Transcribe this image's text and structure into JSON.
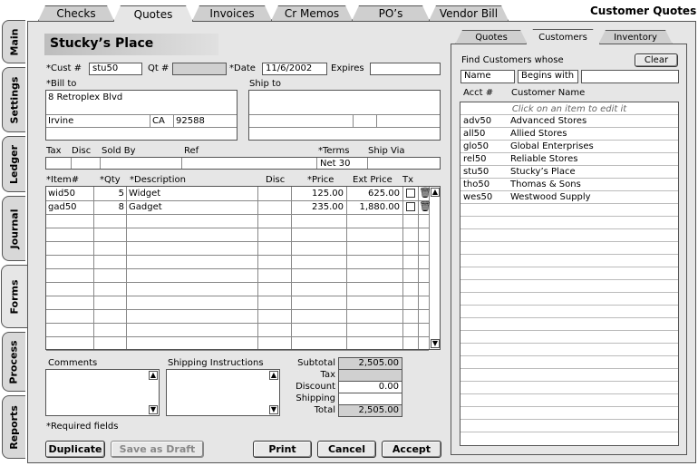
{
  "window_title": "Customer Quotes",
  "left_tabs": [
    "Main",
    "Settings",
    "Ledger",
    "Journal",
    "Forms",
    "Process",
    "Reports"
  ],
  "top_tabs": [
    "Checks",
    "Quotes",
    "Invoices",
    "Cr Memos",
    "PO’s",
    "Vendor Bill"
  ],
  "customer_name": "Stucky’s Place",
  "header": {
    "cust_label": "*Cust #",
    "cust_value": "stu50",
    "qt_label": "Qt #",
    "qt_value": "",
    "date_label": "*Date",
    "date_value": "11/6/2002",
    "expires_label": "Expires",
    "expires_value": ""
  },
  "bill_to": {
    "label": "*Bill to",
    "line1": "8 Retroplex Blvd",
    "city": "Irvine",
    "state": "CA",
    "zip": "92588"
  },
  "ship_to": {
    "label": "Ship to"
  },
  "terms_row": {
    "tax": "Tax",
    "disc": "Disc",
    "sold_by": "Sold By",
    "ref": "Ref",
    "terms": "*Terms",
    "ship_via": "Ship Via",
    "terms_value": "Net 30"
  },
  "items_header": {
    "item": "*Item#",
    "qty": "*Qty",
    "desc": "*Description",
    "disc": "Disc",
    "price": "*Price",
    "ext": "Ext Price",
    "tx": "Tx"
  },
  "items": [
    {
      "item": "wid50",
      "qty": "5",
      "desc": "Widget",
      "price": "125.00",
      "ext": "625.00"
    },
    {
      "item": "gad50",
      "qty": "8",
      "desc": "Gadget",
      "price": "235.00",
      "ext": "1,880.00"
    }
  ],
  "comments_label": "Comments",
  "shipping_label": "Shipping Instructions",
  "totals": {
    "subtotal_label": "Subtotal",
    "subtotal": "2,505.00",
    "tax_label": "Tax",
    "tax": "",
    "discount_label": "Discount",
    "discount": "0.00",
    "shipping_label": "Shipping",
    "shipping": "",
    "total_label": "Total",
    "total": "2,505.00"
  },
  "required_note": "*Required fields",
  "buttons": {
    "duplicate": "Duplicate",
    "save_draft": "Save as Draft",
    "print": "Print",
    "cancel": "Cancel",
    "accept": "Accept"
  },
  "right_tabs": [
    "Quotes",
    "Customers",
    "Inventory"
  ],
  "find": {
    "label": "Find Customers whose",
    "clear": "Clear",
    "field": "Name",
    "op": "Begins with",
    "value": ""
  },
  "list_header": {
    "acct": "Acct #",
    "name": "Customer Name"
  },
  "list_hint": "Click on an item to edit it",
  "customers": [
    {
      "acct": "adv50",
      "name": "Advanced Stores"
    },
    {
      "acct": "all50",
      "name": "Allied Stores"
    },
    {
      "acct": "glo50",
      "name": "Global Enterprises"
    },
    {
      "acct": "rel50",
      "name": "Reliable Stores"
    },
    {
      "acct": "stu50",
      "name": "Stucky’s Place"
    },
    {
      "acct": "tho50",
      "name": "Thomas & Sons"
    },
    {
      "acct": "wes50",
      "name": "Westwood Supply"
    }
  ]
}
